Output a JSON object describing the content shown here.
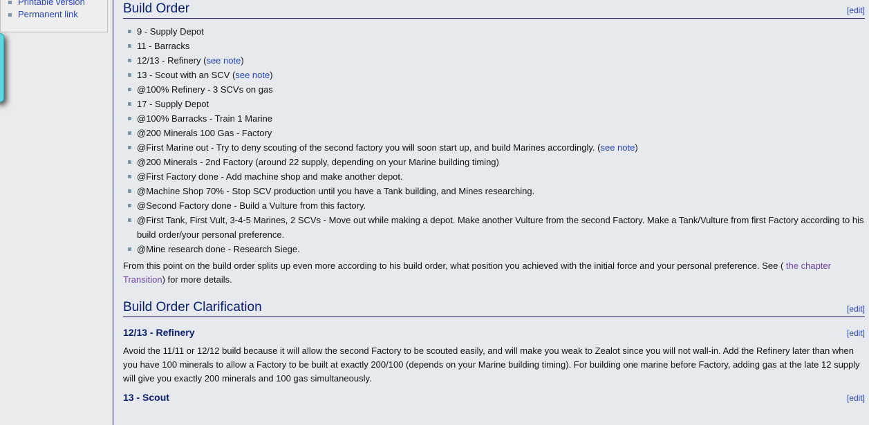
{
  "sidebar": {
    "toolbox": [
      {
        "label": "Printable version"
      },
      {
        "label": "Permanent link"
      }
    ]
  },
  "sections": {
    "build_order": {
      "title": "Build Order",
      "edit": "[edit]",
      "items": [
        {
          "text": "9 - Supply Depot"
        },
        {
          "text": "11 - Barracks"
        },
        {
          "text": "12/13 - Refinery (",
          "link": "see note",
          "after": ")"
        },
        {
          "text": "13 - Scout with an SCV (",
          "link": "see note",
          "after": ")"
        },
        {
          "text": "@100% Refinery - 3 SCVs on gas"
        },
        {
          "text": "17 - Supply Depot"
        },
        {
          "text": "@100% Barracks - Train 1 Marine"
        },
        {
          "text": "@200 Minerals 100 Gas - Factory"
        },
        {
          "text": "@First Marine out - Try to deny scouting of the second factory you will soon start up, and build Marines accordingly. (",
          "link": "see note",
          "after": ")"
        },
        {
          "text": "@200 Minerals - 2nd Factory (around 22 supply, depending on your Marine building timing)"
        },
        {
          "text": "@First Factory done - Add machine shop and make another depot."
        },
        {
          "text": "@Machine Shop 70% - Stop SCV production until you have a Tank building, and Mines researching."
        },
        {
          "text": "@Second Factory done - Build a Vulture from this factory."
        },
        {
          "text": "@First Tank, First Vult, 3-4-5 Marines, 2 SCVs - Move out while making a depot. Make another Vulture from the second Factory. Make a Tank/Vulture from first Factory according to his build order/your personal preference."
        },
        {
          "text": "@Mine research done - Research Siege."
        }
      ],
      "paragraph": {
        "before": "From this point on the build order splits up even more according to his build order, what position you achieved with the initial force and your personal preference. See ( ",
        "link": "the chapter Transition",
        "after": ") for more details."
      }
    },
    "clarification": {
      "title": "Build Order Clarification",
      "edit": "[edit]",
      "refinery": {
        "title": "12/13 - Refinery",
        "edit": "[edit]",
        "text": "Avoid the 11/11 or 12/12 build because it will allow the second Factory to be scouted easily, and will make you weak to Zealot since you will not wall-in. Add the Refinery later than when you have 100 minerals to allow a Factory to be built at exactly 200/100 (depends on your Marine building timing). For building one marine before Factory, adding gas at the late 12 supply will give you exactly 200 minerals and 100 gas simultaneously."
      },
      "scout": {
        "title": "13 - Scout",
        "edit": "[edit]"
      }
    }
  }
}
